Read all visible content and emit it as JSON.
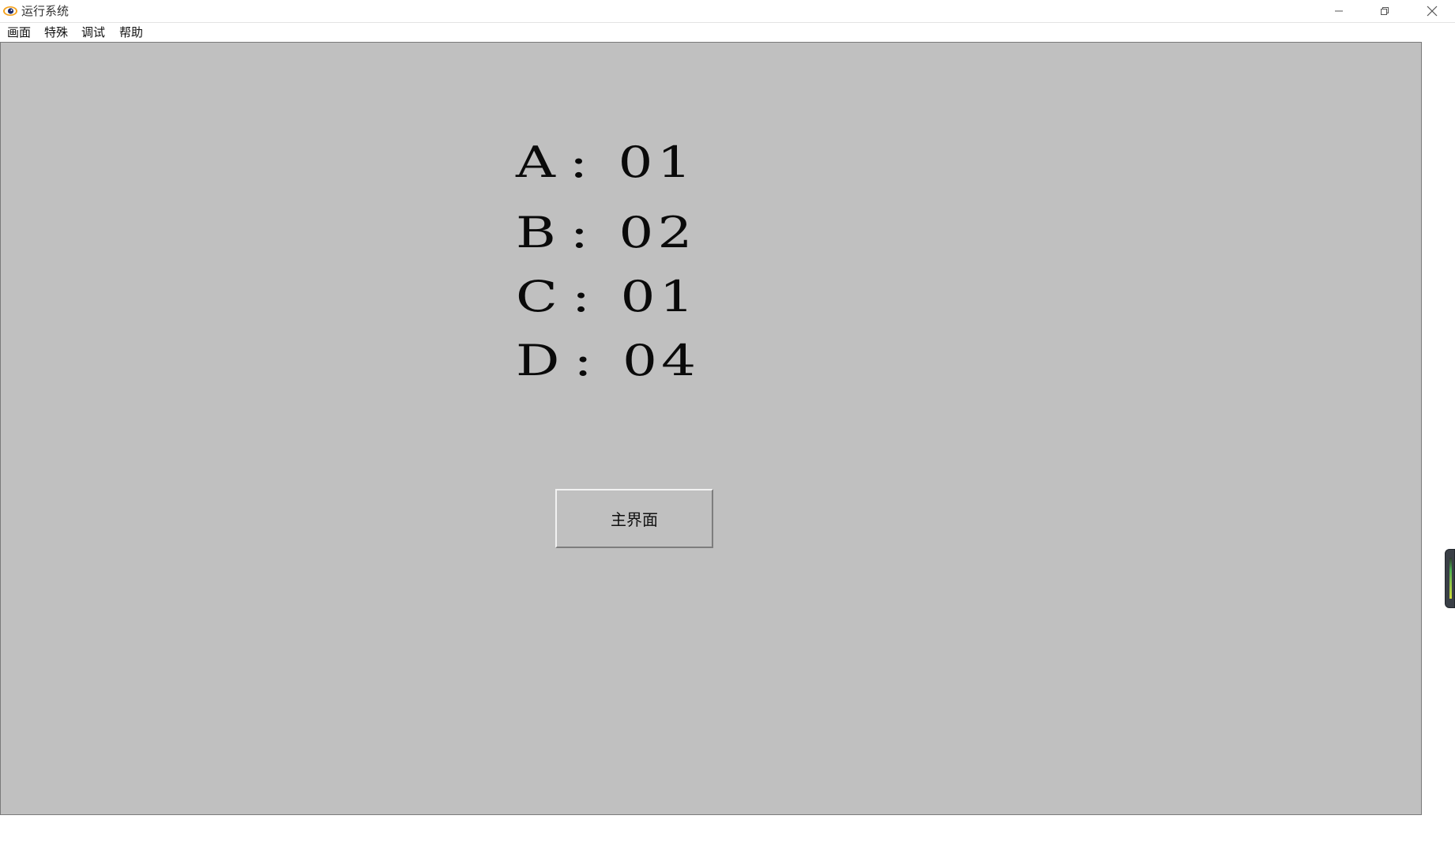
{
  "window": {
    "title": "运行系统",
    "controls": {
      "minimize_icon": "minimize-icon",
      "maximize_icon": "restore-icon",
      "close_icon": "close-icon"
    }
  },
  "menu": {
    "items": [
      {
        "label": "画面"
      },
      {
        "label": "特殊"
      },
      {
        "label": "调试"
      },
      {
        "label": "帮助"
      }
    ]
  },
  "canvas": {
    "background": "#c0c0c0",
    "values": [
      {
        "label": "A",
        "separator": ":",
        "value": "01"
      },
      {
        "label": "B",
        "separator": ":",
        "value": "02"
      },
      {
        "label": "C",
        "separator": ":",
        "value": "01"
      },
      {
        "label": "D",
        "separator": ":",
        "value": "04"
      }
    ],
    "main_button_label": "主界面"
  }
}
